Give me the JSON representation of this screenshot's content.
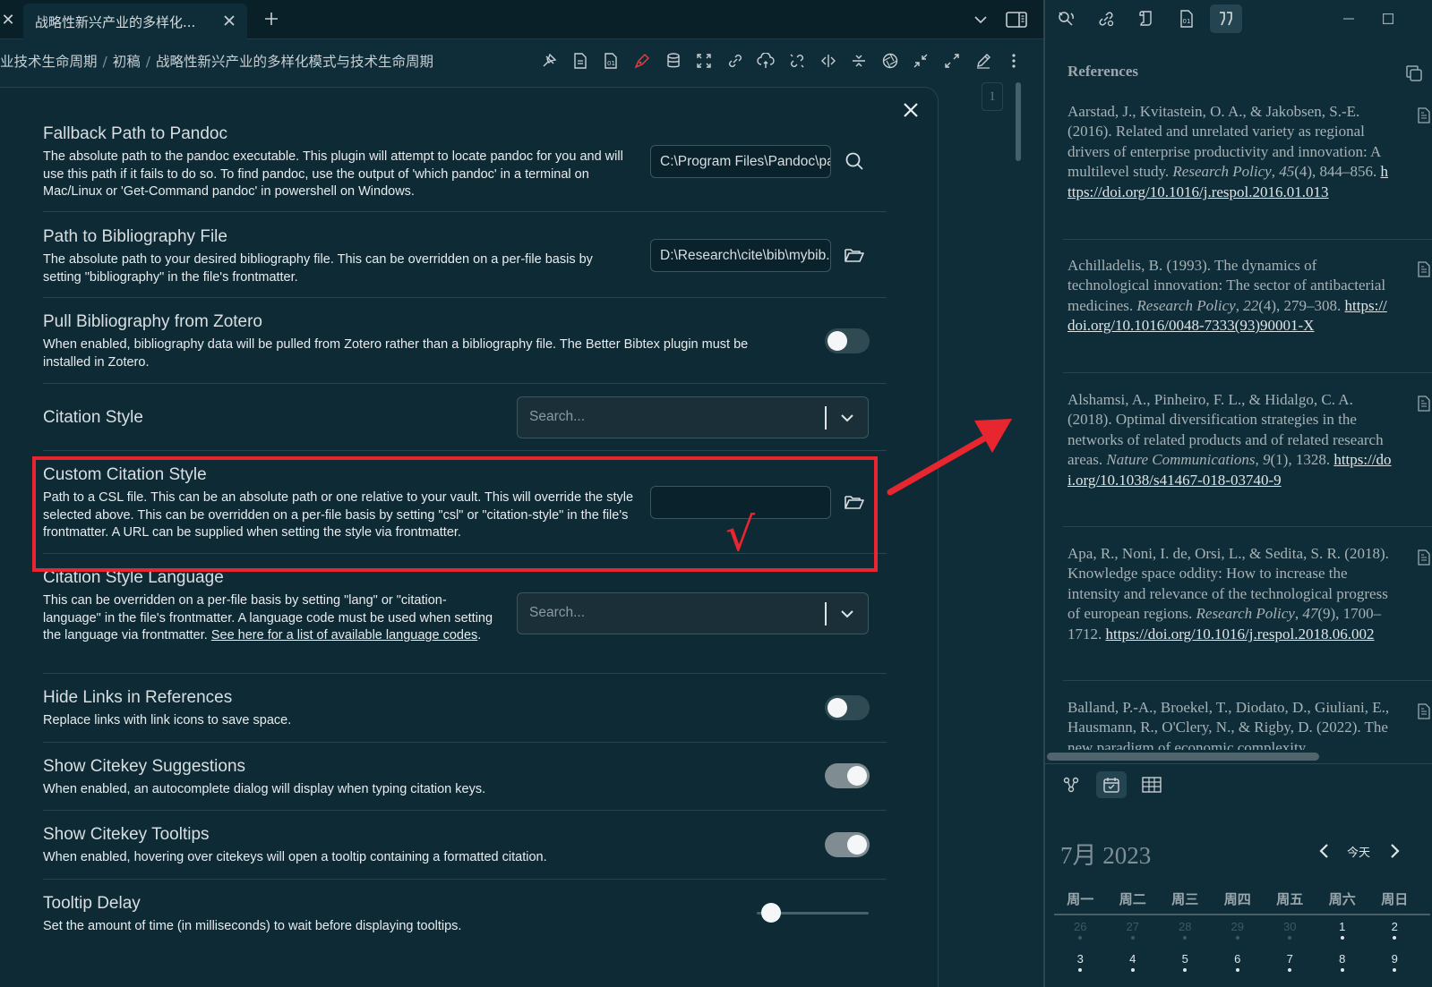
{
  "tabbar": {
    "active_tab_title": "战略性新兴产业的多样化..."
  },
  "breadcrumb": {
    "items": [
      "业技术生命周期",
      "初稿",
      "战略性新兴产业的多样化模式与技术生命周期"
    ],
    "separator": "/"
  },
  "toolbar": {
    "icons": [
      "pin-icon",
      "document-icon",
      "export-icon",
      "pen-icon",
      "database-icon",
      "fullscreen-icon",
      "link-icon",
      "cloud-sync-icon",
      "unlink-icon",
      "code-split-icon",
      "fold-icon",
      "aperture-icon",
      "collapse-icon",
      "expand-icon",
      "edit-icon",
      "more-vertical-icon"
    ]
  },
  "settings": {
    "pandoc": {
      "name": "Fallback Path to Pandoc",
      "desc": "The absolute path to the pandoc executable. This plugin will attempt to locate pandoc for you and will use this path if it fails to do so. To find pandoc, use the output of 'which pandoc' in a terminal on Mac/Linux or 'Get-Command pandoc' in powershell on Windows.",
      "value": "C:\\Program Files\\Pandoc\\pandoc.exe"
    },
    "bibliography": {
      "name": "Path to Bibliography File",
      "desc": "The absolute path to your desired bibliography file. This can be overridden on a per-file basis by setting \"bibliography\" in the file's frontmatter.",
      "value": "D:\\Research\\cite\\bib\\mybib.bib"
    },
    "zotero": {
      "name": "Pull Bibliography from Zotero",
      "desc": "When enabled, bibliography data will be pulled from Zotero rather than a bibliography file. The Better Bibtex plugin must be installed in Zotero.",
      "enabled": false
    },
    "citation_style": {
      "name": "Citation Style",
      "placeholder": "Search..."
    },
    "custom_style": {
      "name": "Custom Citation Style",
      "desc": "Path to a CSL file. This can be an absolute path or one relative to your vault. This will override the style selected above. This can be overridden on a per-file basis by setting \"csl\" or \"citation-style\" in the file's frontmatter. A URL can be supplied when setting the style via frontmatter.",
      "value": ""
    },
    "language": {
      "name": "Citation Style Language",
      "desc": "This can be overridden on a per-file basis by setting \"lang\" or \"citation-language\" in the file's frontmatter. A language code must be used when setting the language via frontmatter.",
      "link": "See here for a list of available language codes",
      "placeholder": "Search..."
    },
    "hide_links": {
      "name": "Hide Links in References",
      "desc": "Replace links with link icons to save space.",
      "enabled": false
    },
    "suggestions": {
      "name": "Show Citekey Suggestions",
      "desc": "When enabled, an autocomplete dialog will display when typing citation keys.",
      "enabled": true
    },
    "tooltips": {
      "name": "Show Citekey Tooltips",
      "desc": "When enabled, hovering over citekeys will open a tooltip containing a formatted citation.",
      "enabled": true
    },
    "tooltip_delay": {
      "name": "Tooltip Delay",
      "desc": "Set the amount of time (in milliseconds) to wait before displaying tooltips.",
      "slider_fraction": 0.13
    }
  },
  "page_counter": "1",
  "annotation": {
    "check": "√",
    "color": "#e8262f"
  },
  "references": {
    "heading": "References",
    "entries": [
      {
        "pre": "Aarstad, J., Kvitastein, O. A., & Jakobsen, S.-E. (2016). Related and unrelated variety as regional drivers of enterprise productivity and innovation: A multilevel study. ",
        "journal": "Research Policy",
        "mid": ", ",
        "volume": "45",
        "post": "(4), 844–856. ",
        "doi": "https://doi.org/10.1016/j.respol.2016.01.013"
      },
      {
        "pre": "Achilladelis, B. (1993). The dynamics of technological innovation: The sector of antibacterial medicines. ",
        "journal": "Research Policy",
        "mid": ", ",
        "volume": "22",
        "post": "(4), 279–308. ",
        "doi": "https://doi.org/10.1016/0048-7333(93)90001-X"
      },
      {
        "pre": "Alshamsi, A., Pinheiro, F. L., & Hidalgo, C. A. (2018). Optimal diversification strategies in the networks of related products and of related research areas. ",
        "journal": "Nature Communications",
        "mid": ", ",
        "volume": "9",
        "post": "(1), 1328. ",
        "doi": "https://doi.org/10.1038/s41467-018-03740-9"
      },
      {
        "pre": "Apa, R., Noni, I. de, Orsi, L., & Sedita, S. R. (2018). Knowledge space oddity: How to increase the intensity and relevance of the technological progress of european regions. ",
        "journal": "Research Policy",
        "mid": ", ",
        "volume": "47",
        "post": "(9), 1700–1712. ",
        "doi": "https://doi.org/10.1016/j.respol.2018.06.002"
      },
      {
        "pre": "Balland, P.-A., Broekel, T., Diodato, D., Giuliani, E., Hausmann, R., O'Clery, N., & Rigby, D. (2022). The new paradigm of economic complexity",
        "journal": "",
        "mid": "",
        "volume": "",
        "post": "",
        "doi": ""
      }
    ]
  },
  "calendar": {
    "month_label": "7月 2023",
    "today_label": "今天",
    "weekdays": [
      "周一",
      "周二",
      "周三",
      "周四",
      "周五",
      "周六",
      "周日"
    ],
    "row1": [
      {
        "d": "26",
        "out": true
      },
      {
        "d": "27",
        "out": true
      },
      {
        "d": "28",
        "out": true
      },
      {
        "d": "29",
        "out": true
      },
      {
        "d": "30",
        "out": true
      },
      {
        "d": "1",
        "out": false
      },
      {
        "d": "2",
        "out": false
      }
    ],
    "row2": [
      {
        "d": "3",
        "out": false
      },
      {
        "d": "4",
        "out": false
      },
      {
        "d": "5",
        "out": false
      },
      {
        "d": "6",
        "out": false
      },
      {
        "d": "7",
        "out": false
      },
      {
        "d": "8",
        "out": false
      },
      {
        "d": "9",
        "out": false
      }
    ]
  }
}
